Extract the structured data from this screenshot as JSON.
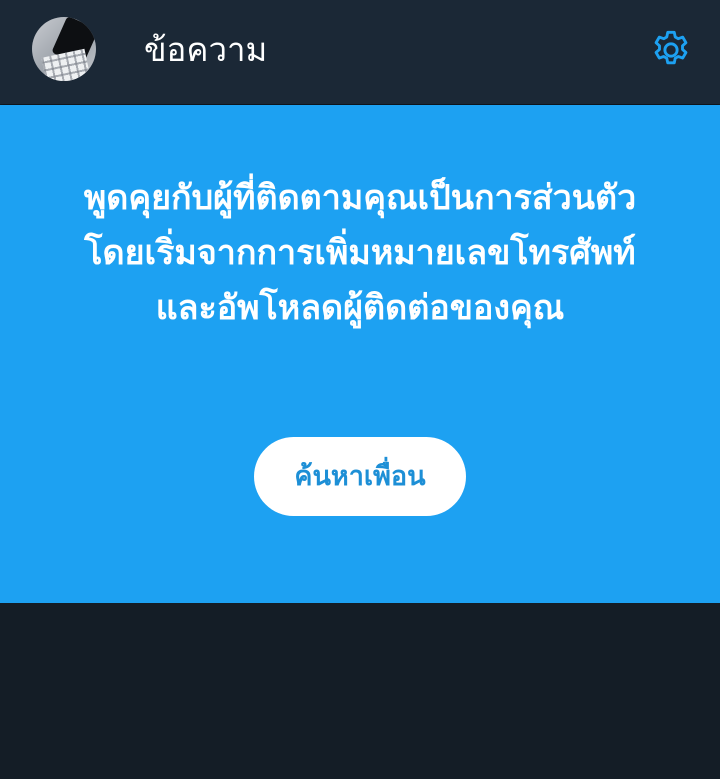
{
  "header": {
    "title": "ข้อความ",
    "avatar_icon": "profile-avatar",
    "settings_icon": "gear-icon"
  },
  "banner": {
    "message": "พูดคุยกับผู้ที่ติดตามคุณเป็นการส่วนตัว โดยเริ่มจากการเพิ่มหมายเลขโทรศัพท์และอัพโหลดผู้ติดต่อของคุณ",
    "button_label": "ค้นหาเพื่อน"
  },
  "colors": {
    "header_bg": "#1b2836",
    "page_bg": "#141d26",
    "banner_bg": "#1da1f2",
    "accent": "#1da1f2",
    "button_text": "#1d8fd6"
  }
}
